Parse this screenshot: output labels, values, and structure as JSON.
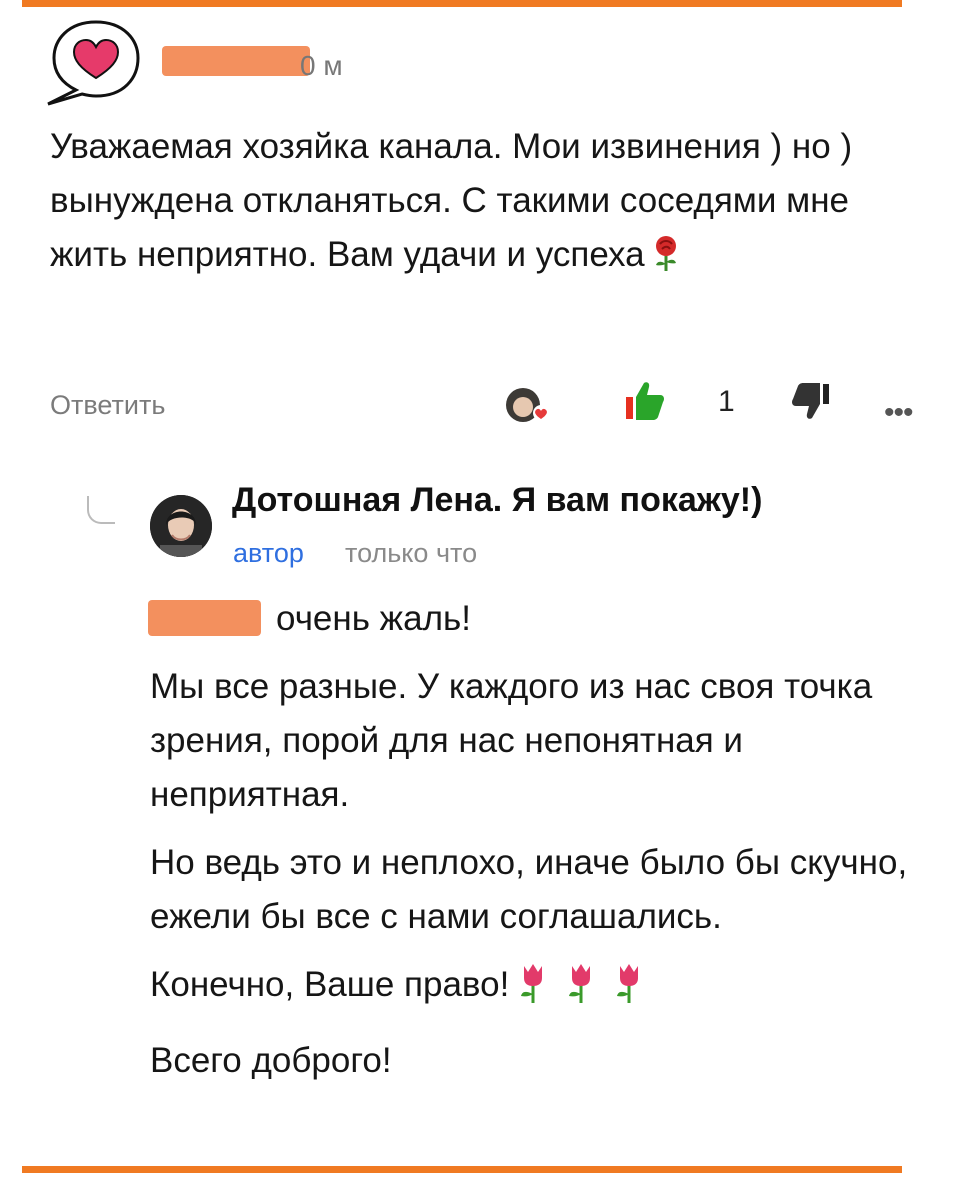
{
  "comment": {
    "time_suffix": "0 м",
    "text": "Уважаемая хозяйка канала. Мои извинения ) но ) вынуждена откланяться. С такими соседями мне жить неприятно. Вам удачи и успеха"
  },
  "actions": {
    "reply_label": "Ответить",
    "like_count": "1"
  },
  "reply": {
    "author_name": "Дотошная Лена. Я вам покажу!)",
    "badge": "автор",
    "time": "только что",
    "line1": "очень жаль!",
    "para2": "Мы все разные. У каждого из нас своя точка зрения, порой для нас непонятная и неприятная.",
    "para3": "Но ведь это и неплохо, иначе было бы скучно, ежели бы все с нами соглашались.",
    "para4": "Конечно, Ваше право!",
    "para5": "Всего доброго!"
  },
  "colors": {
    "accent_orange": "#f07a22",
    "author_blue": "#2f6fe0"
  },
  "icons": [
    "heart-avatar-icon",
    "rose-icon",
    "like-icon",
    "dislike-icon",
    "more-icon",
    "tulip-icon"
  ]
}
